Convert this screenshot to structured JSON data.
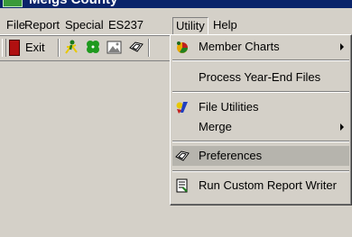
{
  "window": {
    "title": "Meigs County"
  },
  "menubar": {
    "items": [
      {
        "label": "File"
      },
      {
        "label": "Report"
      },
      {
        "label": "Special"
      },
      {
        "label": "ES237"
      },
      {
        "label": "Utility"
      },
      {
        "label": "Help"
      }
    ]
  },
  "toolbar": {
    "exit_label": "Exit",
    "icons": [
      "exit-icon",
      "runner-icon",
      "clover-icon",
      "image-icon",
      "preferences-icon"
    ]
  },
  "utility_menu": {
    "items": [
      {
        "label": "Member Charts",
        "icon": "member-charts-icon",
        "submenu": true
      },
      {
        "label": "Process Year-End Files",
        "submenu": false
      },
      {
        "label": "File Utilities",
        "icon": "file-utilities-icon",
        "submenu": false
      },
      {
        "label": "Merge",
        "submenu": true
      },
      {
        "label": "Preferences",
        "icon": "preferences-icon",
        "submenu": false,
        "highlighted": true
      },
      {
        "label": "Run Custom Report Writer",
        "icon": "report-writer-icon",
        "submenu": false
      }
    ]
  },
  "colors": {
    "face": "#d4d0c8",
    "titlebar": "#0a246a",
    "highlight": "#b6b4ad"
  }
}
